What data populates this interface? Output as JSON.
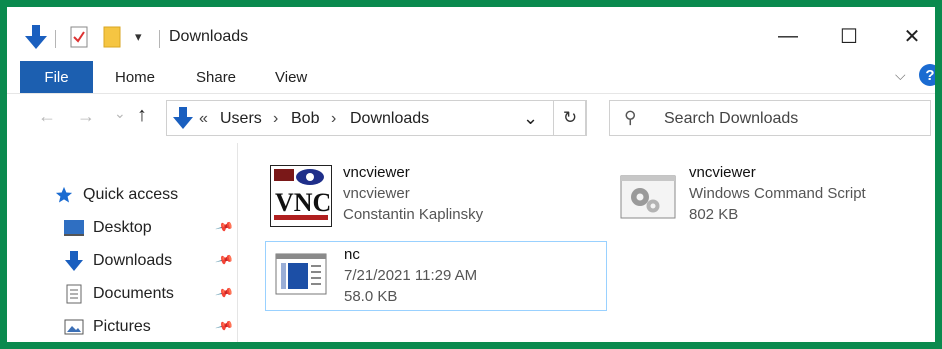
{
  "window": {
    "title": "Downloads",
    "minimize": "—",
    "maximize": "☐",
    "close": "✕"
  },
  "quick_access": {
    "dropdown": "▾"
  },
  "ribbon": {
    "tabs": [
      "File",
      "Home",
      "Share",
      "View"
    ],
    "expand": "⌵",
    "help": "?"
  },
  "nav": {
    "back": "←",
    "forward": "→",
    "recent": "⌄",
    "up": "↑",
    "overflow": "«",
    "breadcrumb": [
      "Users",
      "Bob",
      "Downloads"
    ],
    "separator": "›",
    "dropdown": "⌄",
    "refresh": "↻"
  },
  "search": {
    "placeholder": "Search Downloads",
    "icon": "⚲"
  },
  "sidebar": {
    "quick_access_label": "Quick access",
    "items": [
      {
        "label": "Desktop",
        "pinned": true
      },
      {
        "label": "Downloads",
        "pinned": true
      },
      {
        "label": "Documents",
        "pinned": true
      },
      {
        "label": "Pictures",
        "pinned": true
      }
    ]
  },
  "files": [
    {
      "name": "vncviewer",
      "line1": "vncviewer",
      "line2": "Constantin Kaplinsky",
      "icon": "vnc-app-icon",
      "logo_text": "VNC"
    },
    {
      "name": "vncviewer",
      "line1": "Windows Command Script",
      "line2": "802 KB",
      "icon": "cmd-script-icon"
    },
    {
      "name": "nc",
      "line1": "7/21/2021 11:29 AM",
      "line2": "58.0 KB",
      "icon": "application-icon",
      "selected": true
    }
  ],
  "colors": {
    "border": "#0a8a4e",
    "accent": "#1c5fb0",
    "selection": "#99d1ff"
  }
}
